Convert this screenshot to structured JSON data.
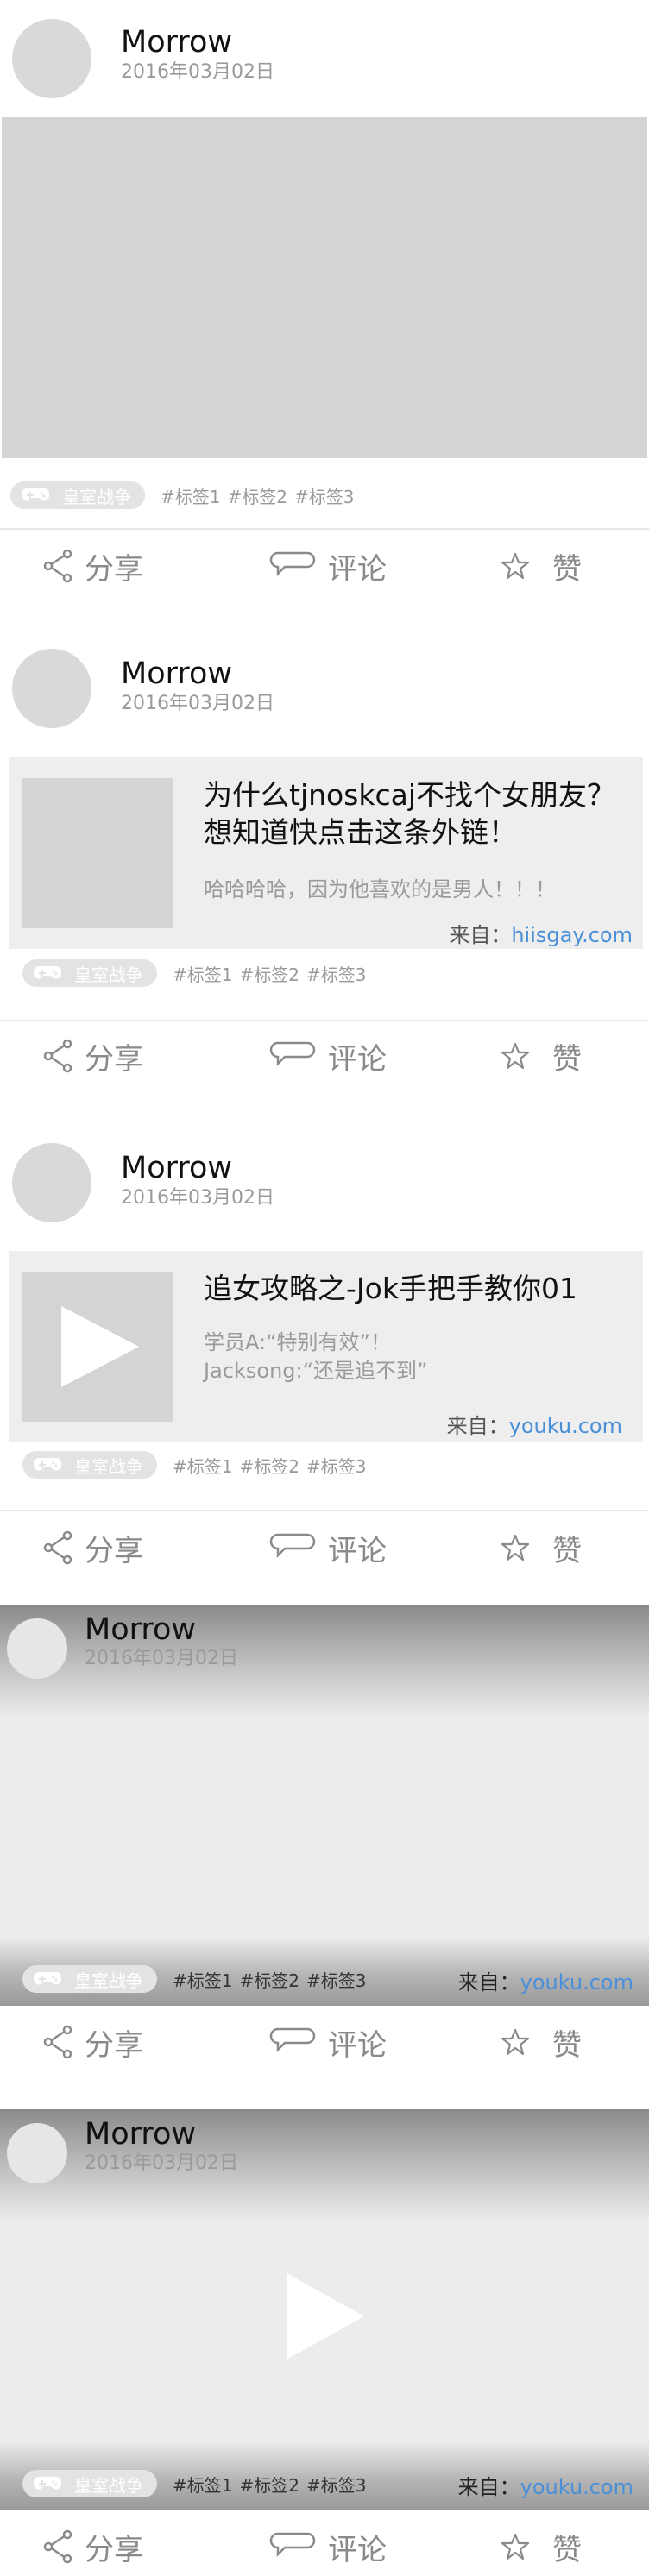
{
  "posts": [
    {
      "user": "Morrow",
      "date": "2016年03月02日",
      "game": "皇室战争",
      "tags": [
        "#标签1",
        "#标签2",
        "#标签3"
      ]
    },
    {
      "user": "Morrow",
      "date": "2016年03月02日",
      "card": {
        "title": "为什么tjnoskcaj不找个女朋友？想知道快点击这条外链！",
        "desc": [
          "哈哈哈哈，因为他喜欢的是男人！！！"
        ],
        "source_label": "来自：",
        "source": "hiisgay.com"
      },
      "game": "皇室战争",
      "tags": [
        "#标签1",
        "#标签2",
        "#标签3"
      ]
    },
    {
      "user": "Morrow",
      "date": "2016年03月02日",
      "card": {
        "title": "追女攻略之-Jok手把手教你01",
        "desc": [
          "学员A:“特别有效”！",
          "Jacksong:“还是追不到”"
        ],
        "source_label": "来自：",
        "source": "youku.com"
      },
      "game": "皇室战争",
      "tags": [
        "#标签1",
        "#标签2",
        "#标签3"
      ]
    },
    {
      "user": "Morrow",
      "date": "2016年03月02日",
      "game": "皇室战争",
      "tags": [
        "#标签1",
        "#标签2",
        "#标签3"
      ],
      "source_label": "来自：",
      "source": "youku.com"
    },
    {
      "user": "Morrow",
      "date": "2016年03月02日",
      "game": "皇室战争",
      "tags": [
        "#标签1",
        "#标签2",
        "#标签3"
      ],
      "source_label": "来自：",
      "source": "youku.com"
    }
  ],
  "actions": {
    "share": "分享",
    "comment": "评论",
    "like": "赞"
  },
  "icons": {
    "share": "share-icon",
    "comment": "comment-bubble-icon",
    "like": "star-icon",
    "game": "gamepad-icon",
    "play": "play-icon"
  },
  "colors": {
    "link": "#4a90d9",
    "placeholder": "#d4d4d4",
    "action_text": "#8a8a8a"
  }
}
